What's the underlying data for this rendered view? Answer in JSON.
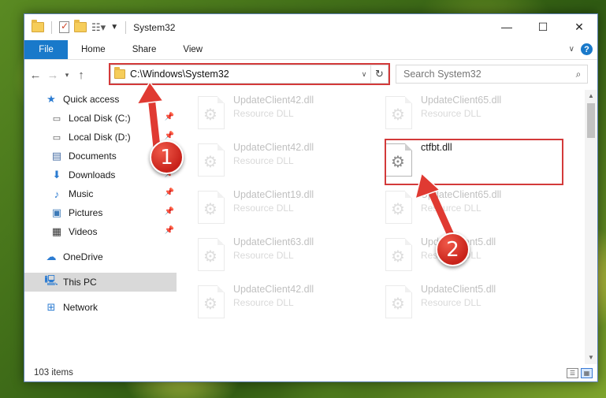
{
  "titlebar": {
    "title": "System32",
    "controls": {
      "minimize": "—",
      "maximize": "☐",
      "close": "✕"
    },
    "quick_access_icons": [
      "folder-icon",
      "properties-icon",
      "new-folder-icon",
      "customize-icon"
    ]
  },
  "ribbon": {
    "tabs": [
      "File",
      "Home",
      "Share",
      "View"
    ],
    "help": "?"
  },
  "address_bar": {
    "path": "C:\\Windows\\System32",
    "search_placeholder": "Search System32"
  },
  "navigation_pane": {
    "quick_access": "Quick access",
    "items": [
      {
        "label": "Local Disk (C:)",
        "icon": "drive-icon",
        "pinned": true
      },
      {
        "label": "Local Disk (D:)",
        "icon": "drive-icon",
        "pinned": true
      },
      {
        "label": "Documents",
        "icon": "documents-icon",
        "pinned": true
      },
      {
        "label": "Downloads",
        "icon": "downloads-icon",
        "pinned": true
      },
      {
        "label": "Music",
        "icon": "music-icon",
        "pinned": true
      },
      {
        "label": "Pictures",
        "icon": "pictures-icon",
        "pinned": true
      },
      {
        "label": "Videos",
        "icon": "videos-icon",
        "pinned": true
      }
    ],
    "onedrive": "OneDrive",
    "this_pc": "This PC",
    "network": "Network"
  },
  "files": [
    {
      "name": "UpdateClient42.dll",
      "type": "Resource DLL",
      "highlighted": false
    },
    {
      "name": "UpdateClient65.dll",
      "type": "Resource DLL",
      "highlighted": false
    },
    {
      "name": "UpdateClient42.dll",
      "type": "Resource DLL",
      "highlighted": false
    },
    {
      "name": "ctfbt.dll",
      "type": "",
      "highlighted": true
    },
    {
      "name": "UpdateClient19.dll",
      "type": "Resource DLL",
      "highlighted": false
    },
    {
      "name": "UpdateClient65.dll",
      "type": "Resource DLL",
      "highlighted": false
    },
    {
      "name": "UpdateClient63.dll",
      "type": "Resource DLL",
      "highlighted": false
    },
    {
      "name": "UpdateClient5.dll",
      "type": "Resource DLL",
      "highlighted": false
    },
    {
      "name": "UpdateClient42.dll",
      "type": "Resource DLL",
      "highlighted": false
    },
    {
      "name": "UpdateClient5.dll",
      "type": "Resource DLL",
      "highlighted": false
    }
  ],
  "status": {
    "item_count": "103 items"
  },
  "annotations": {
    "step1": "1",
    "step2": "2"
  },
  "colors": {
    "accent": "#1979ca",
    "annotation_red": "#d33a3a",
    "selected_bg": "#d9d9d9"
  }
}
